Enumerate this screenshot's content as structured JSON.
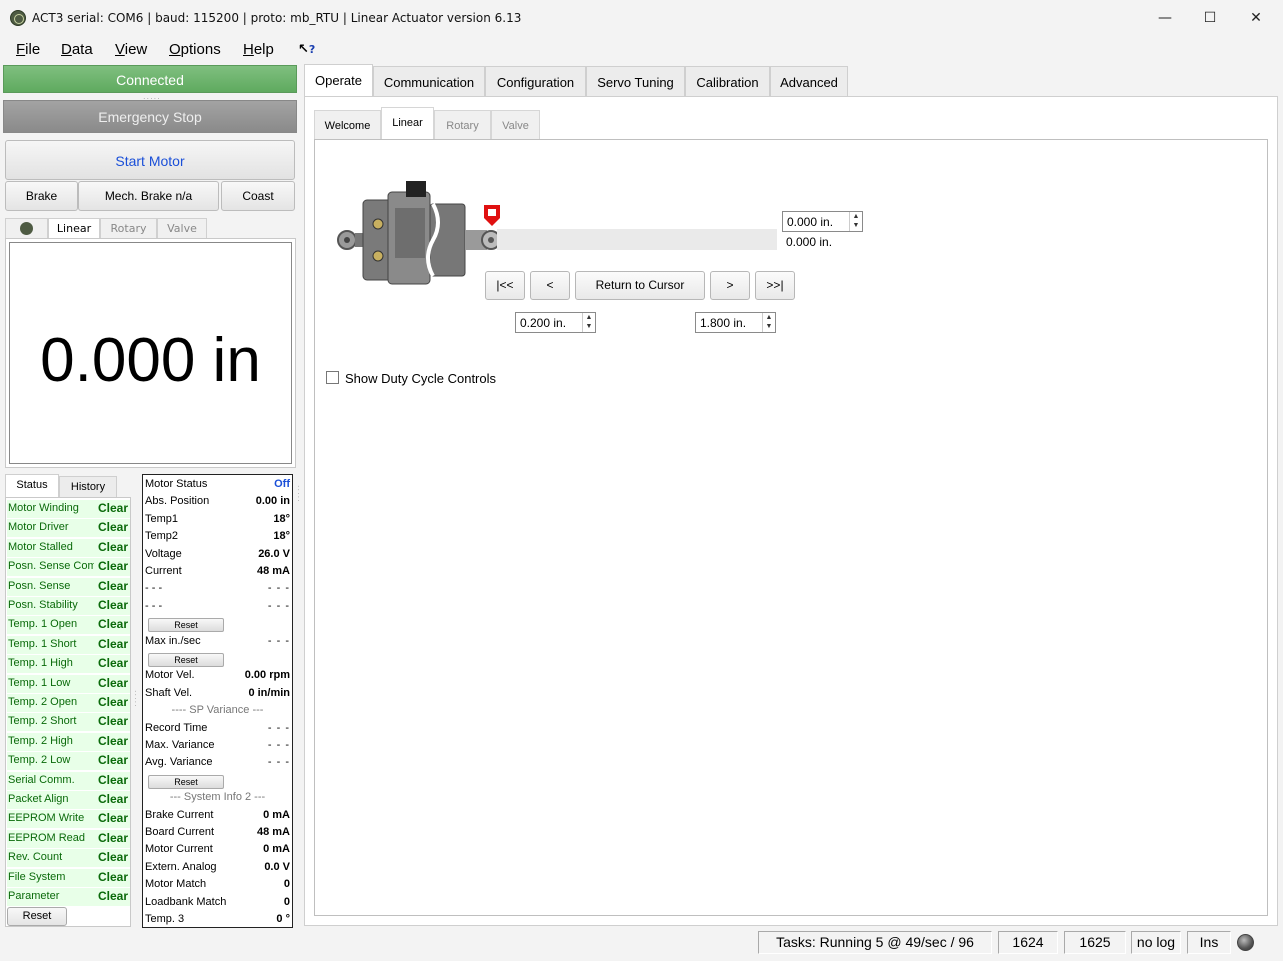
{
  "window": {
    "title": "ACT3   serial: COM6  |  baud: 115200  |  proto: mb_RTU  |  Linear Actuator version 6.13",
    "controls": [
      "—",
      "☐",
      "✕"
    ]
  },
  "menu": [
    "File",
    "Data",
    "View",
    "Options",
    "Help"
  ],
  "left": {
    "connected_label": "Connected",
    "estop_label": "Emergency Stop",
    "start_motor_label": "Start Motor",
    "brake_label": "Brake",
    "mech_brake_label": "Mech. Brake n/a",
    "coast_label": "Coast",
    "tabs": [
      "Linear",
      "Rotary",
      "Valve"
    ],
    "readout": "0.000 in"
  },
  "status": {
    "tabs": [
      "Status",
      "History"
    ],
    "rows": [
      {
        "name": "Motor Winding",
        "value": "Clear"
      },
      {
        "name": "Motor Driver",
        "value": "Clear"
      },
      {
        "name": "Motor Stalled",
        "value": "Clear"
      },
      {
        "name": "Posn. Sense Com",
        "value": "Clear"
      },
      {
        "name": "Posn. Sense",
        "value": "Clear"
      },
      {
        "name": "Posn. Stability",
        "value": "Clear"
      },
      {
        "name": "Temp. 1 Open",
        "value": "Clear"
      },
      {
        "name": "Temp. 1 Short",
        "value": "Clear"
      },
      {
        "name": "Temp. 1 High",
        "value": "Clear"
      },
      {
        "name": "Temp. 1 Low",
        "value": "Clear"
      },
      {
        "name": "Temp. 2 Open",
        "value": "Clear"
      },
      {
        "name": "Temp. 2 Short",
        "value": "Clear"
      },
      {
        "name": "Temp. 2 High",
        "value": "Clear"
      },
      {
        "name": "Temp. 2 Low",
        "value": "Clear"
      },
      {
        "name": "Serial Comm.",
        "value": "Clear"
      },
      {
        "name": "Packet Align",
        "value": "Clear"
      },
      {
        "name": "EEPROM Write",
        "value": "Clear"
      },
      {
        "name": "EEPROM Read",
        "value": "Clear"
      },
      {
        "name": "Rev. Count",
        "value": "Clear"
      },
      {
        "name": "File System",
        "value": "Clear"
      },
      {
        "name": "Parameter",
        "value": "Clear"
      }
    ],
    "reset_label": "Reset"
  },
  "motor_info": {
    "reset_label": "Reset",
    "rows": [
      {
        "name": "Motor Status",
        "value": "Off",
        "style": "blue"
      },
      {
        "name": "Abs. Position",
        "value": "0.00 in"
      },
      {
        "name": "Temp1",
        "value": "18°"
      },
      {
        "name": "Temp2",
        "value": "18°"
      },
      {
        "name": "Voltage",
        "value": "26.0 V"
      },
      {
        "name": "Current",
        "value": "48 mA"
      },
      {
        "name": "- - -",
        "value": "- - -",
        "style": "dash"
      },
      {
        "name": "- - -",
        "value": "- - -",
        "style": "dash"
      },
      {
        "name": "",
        "value": "",
        "reset": true
      },
      {
        "name": "Max in./sec",
        "value": "- - -",
        "style": "dash"
      },
      {
        "name": "",
        "value": "",
        "reset": true
      },
      {
        "name": "Motor Vel.",
        "value": "0.00 rpm"
      },
      {
        "name": "Shaft Vel.",
        "value": "0 in/min"
      },
      {
        "name": "---- SP Variance ---",
        "value": "",
        "style": "center"
      },
      {
        "name": "Record Time",
        "value": "- - -",
        "style": "dash"
      },
      {
        "name": "Max. Variance",
        "value": "- - -",
        "style": "dash"
      },
      {
        "name": "Avg. Variance",
        "value": "- - -",
        "style": "dash"
      },
      {
        "name": "",
        "value": "",
        "reset": true
      },
      {
        "name": "--- System Info 2 ---",
        "value": "",
        "style": "center"
      },
      {
        "name": "Brake Current",
        "value": "0 mA"
      },
      {
        "name": "Board Current",
        "value": "48 mA"
      },
      {
        "name": "Motor Current",
        "value": "0 mA"
      },
      {
        "name": "Extern. Analog",
        "value": "0.0 V"
      },
      {
        "name": "Motor Match",
        "value": "0"
      },
      {
        "name": "Loadbank Match",
        "value": "0"
      },
      {
        "name": "Temp. 3",
        "value": "0 °"
      }
    ]
  },
  "main": {
    "tabs": [
      "Operate",
      "Communication",
      "Configuration",
      "Servo Tuning",
      "Calibration",
      "Advanced"
    ],
    "subtabs": [
      "Welcome",
      "Linear",
      "Rotary",
      "Valve"
    ],
    "target_position": "0.000 in.",
    "current_position": "0.000 in.",
    "nav_buttons": [
      "|<<",
      "<",
      "Return to Cursor",
      ">",
      ">>|"
    ],
    "min_limit": "0.200 in.",
    "max_limit": "1.800 in.",
    "duty_cycle_label": "Show Duty Cycle Controls"
  },
  "statusbar": {
    "tasks": "Tasks: Running 5 @ 49/sec / 96",
    "field1": "1624",
    "field2": "1625",
    "log": "no log",
    "mode": "Ins"
  }
}
